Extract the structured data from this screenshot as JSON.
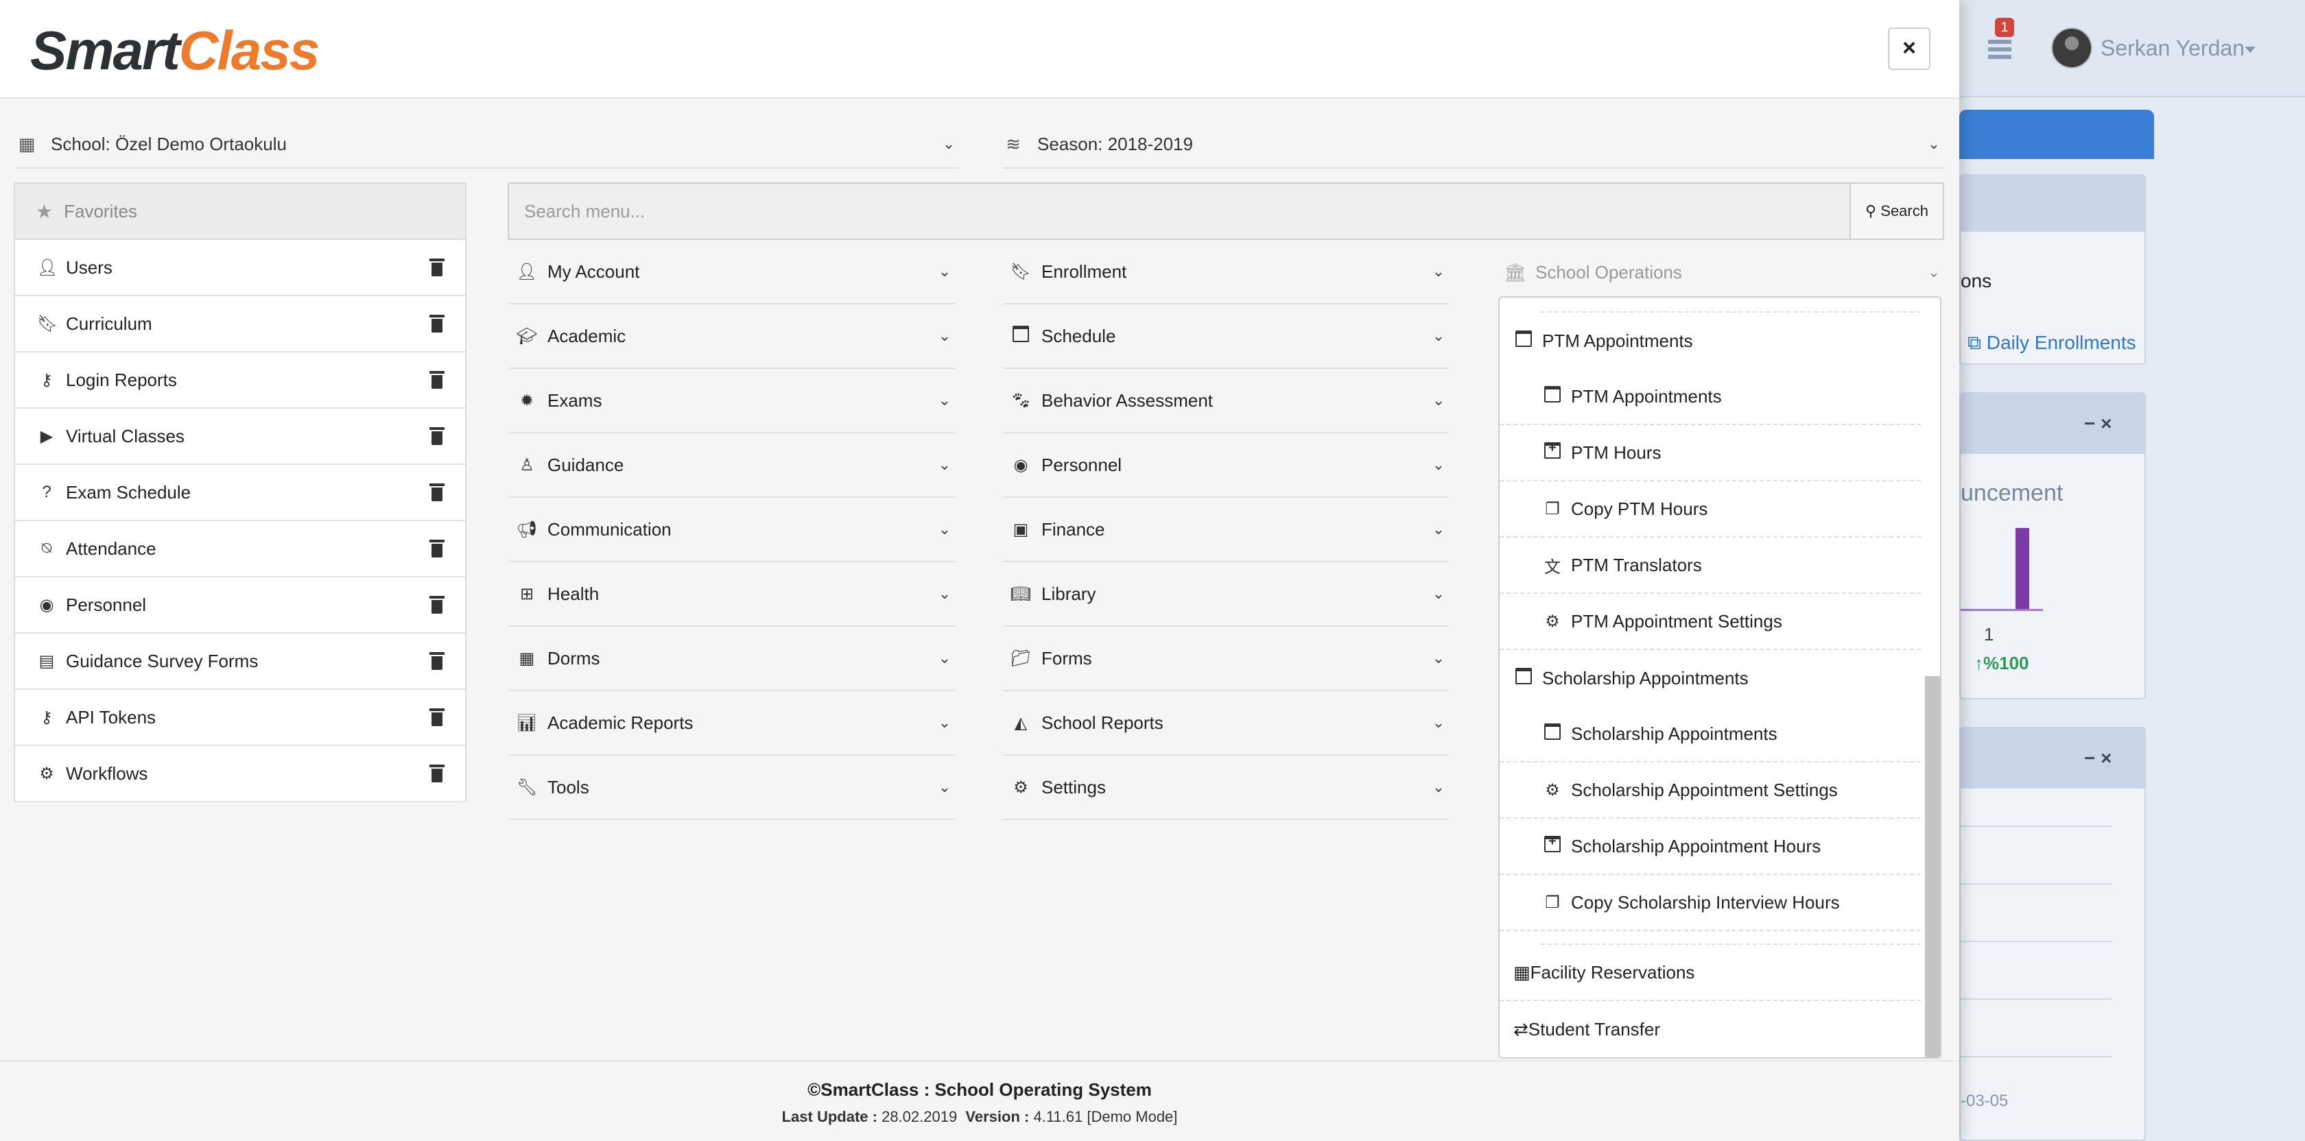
{
  "app": {
    "logo_smart": "Smart",
    "logo_class": "Class",
    "close_label": "×"
  },
  "background": {
    "notification_count": "1",
    "user_name": "Serkan Yerdan",
    "card1_text": "ons",
    "card1_link": "Daily Enrollments",
    "card2_title": "uncement",
    "card2_value": "1",
    "card2_pct": "%100",
    "card_controls": "− ×",
    "card3_date": "-03-05"
  },
  "selectors": {
    "school": "School: Özel Demo Ortaokulu",
    "season": "Season: 2018-2019"
  },
  "favorites": {
    "title": "Favorites",
    "items": [
      {
        "label": "Users",
        "icon": "user-icon"
      },
      {
        "label": "Curriculum",
        "icon": "bookmark-icon"
      },
      {
        "label": "Login Reports",
        "icon": "key-icon"
      },
      {
        "label": "Virtual Classes",
        "icon": "video-icon"
      },
      {
        "label": "Exam Schedule",
        "icon": "question-circle-icon"
      },
      {
        "label": "Attendance",
        "icon": "bell-slash-icon"
      },
      {
        "label": "Personnel",
        "icon": "user-circle-icon"
      },
      {
        "label": "Guidance Survey Forms",
        "icon": "form-icon"
      },
      {
        "label": "API Tokens",
        "icon": "key-icon"
      },
      {
        "label": "Workflows",
        "icon": "gears-icon"
      }
    ]
  },
  "search": {
    "placeholder": "Search menu...",
    "button_label": "Search"
  },
  "menu": {
    "col1": [
      {
        "label": "My Account",
        "icon": "user-icon"
      },
      {
        "label": "Academic",
        "icon": "graduation-cap-icon"
      },
      {
        "label": "Exams",
        "icon": "certificate-icon"
      },
      {
        "label": "Guidance",
        "icon": "user-tie-icon"
      },
      {
        "label": "Communication",
        "icon": "bullhorn-icon"
      },
      {
        "label": "Health",
        "icon": "medkit-icon"
      },
      {
        "label": "Dorms",
        "icon": "building-icon"
      },
      {
        "label": "Academic Reports",
        "icon": "bar-chart-icon"
      },
      {
        "label": "Tools",
        "icon": "wrench-icon"
      }
    ],
    "col2": [
      {
        "label": "Enrollment",
        "icon": "bookmark-icon"
      },
      {
        "label": "Schedule",
        "icon": "calendar-icon"
      },
      {
        "label": "Behavior Assessment",
        "icon": "paw-icon"
      },
      {
        "label": "Personnel",
        "icon": "user-circle-icon"
      },
      {
        "label": "Finance",
        "icon": "money-icon"
      },
      {
        "label": "Library",
        "icon": "book-icon"
      },
      {
        "label": "Forms",
        "icon": "folder-icon"
      },
      {
        "label": "School Reports",
        "icon": "area-chart-icon"
      },
      {
        "label": "Settings",
        "icon": "gears-icon"
      }
    ],
    "school_operations": {
      "label": "School Operations",
      "groups": [
        {
          "label": "PTM Appointments",
          "items": [
            "PTM Appointments",
            "PTM Hours",
            "Copy PTM Hours",
            "PTM Translators",
            "PTM Appointment Settings"
          ]
        },
        {
          "label": "Scholarship Appointments",
          "items": [
            "Scholarship Appointments",
            "Scholarship Appointment Settings",
            "Scholarship Appointment Hours",
            "Copy Scholarship Interview Hours"
          ]
        }
      ],
      "top_items": [
        "Facility Reservations",
        "Student Transfer"
      ]
    }
  },
  "footer": {
    "line1": "©SmartClass : School Operating System",
    "last_update_label": "Last Update :",
    "last_update_value": "28.02.2019",
    "version_label": "Version :",
    "version_value": "4.11.61 [Demo Mode]"
  }
}
